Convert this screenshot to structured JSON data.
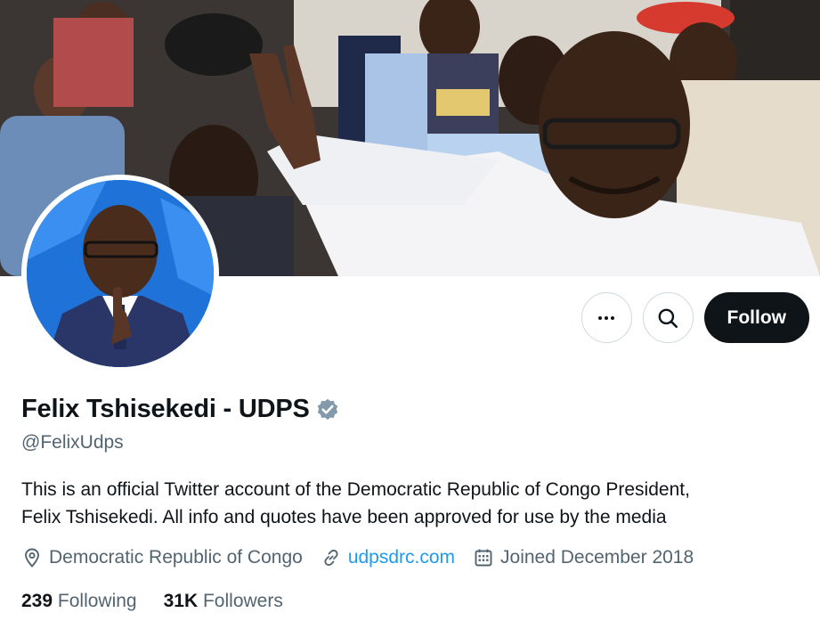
{
  "profile": {
    "display_name": "Felix Tshisekedi - UDPS",
    "handle": "@FelixUdps",
    "verified_badge": "verified-badge-icon",
    "bio_line1": "This is an official Twitter account of the Democratic Republic of Congo President,",
    "bio_line2": "Felix Tshisekedi. All info and quotes have been approved for use by the media"
  },
  "actions": {
    "more_icon": "more-horizontal-icon",
    "search_icon": "search-icon",
    "follow_label": "Follow"
  },
  "meta": {
    "location": "Democratic Republic of Congo",
    "location_icon": "location-pin-icon",
    "website": "udpsdrc.com",
    "website_icon": "link-icon",
    "joined": "Joined December 2018",
    "joined_icon": "calendar-icon"
  },
  "stats": {
    "following_count": "239",
    "following_label": "Following",
    "followers_count": "31K",
    "followers_label": "Followers"
  },
  "colors": {
    "accent": "#1d9bf0",
    "text_primary": "#0f1419",
    "text_secondary": "#536471",
    "follow_bg": "#0f1419",
    "verified": "#829aab"
  }
}
